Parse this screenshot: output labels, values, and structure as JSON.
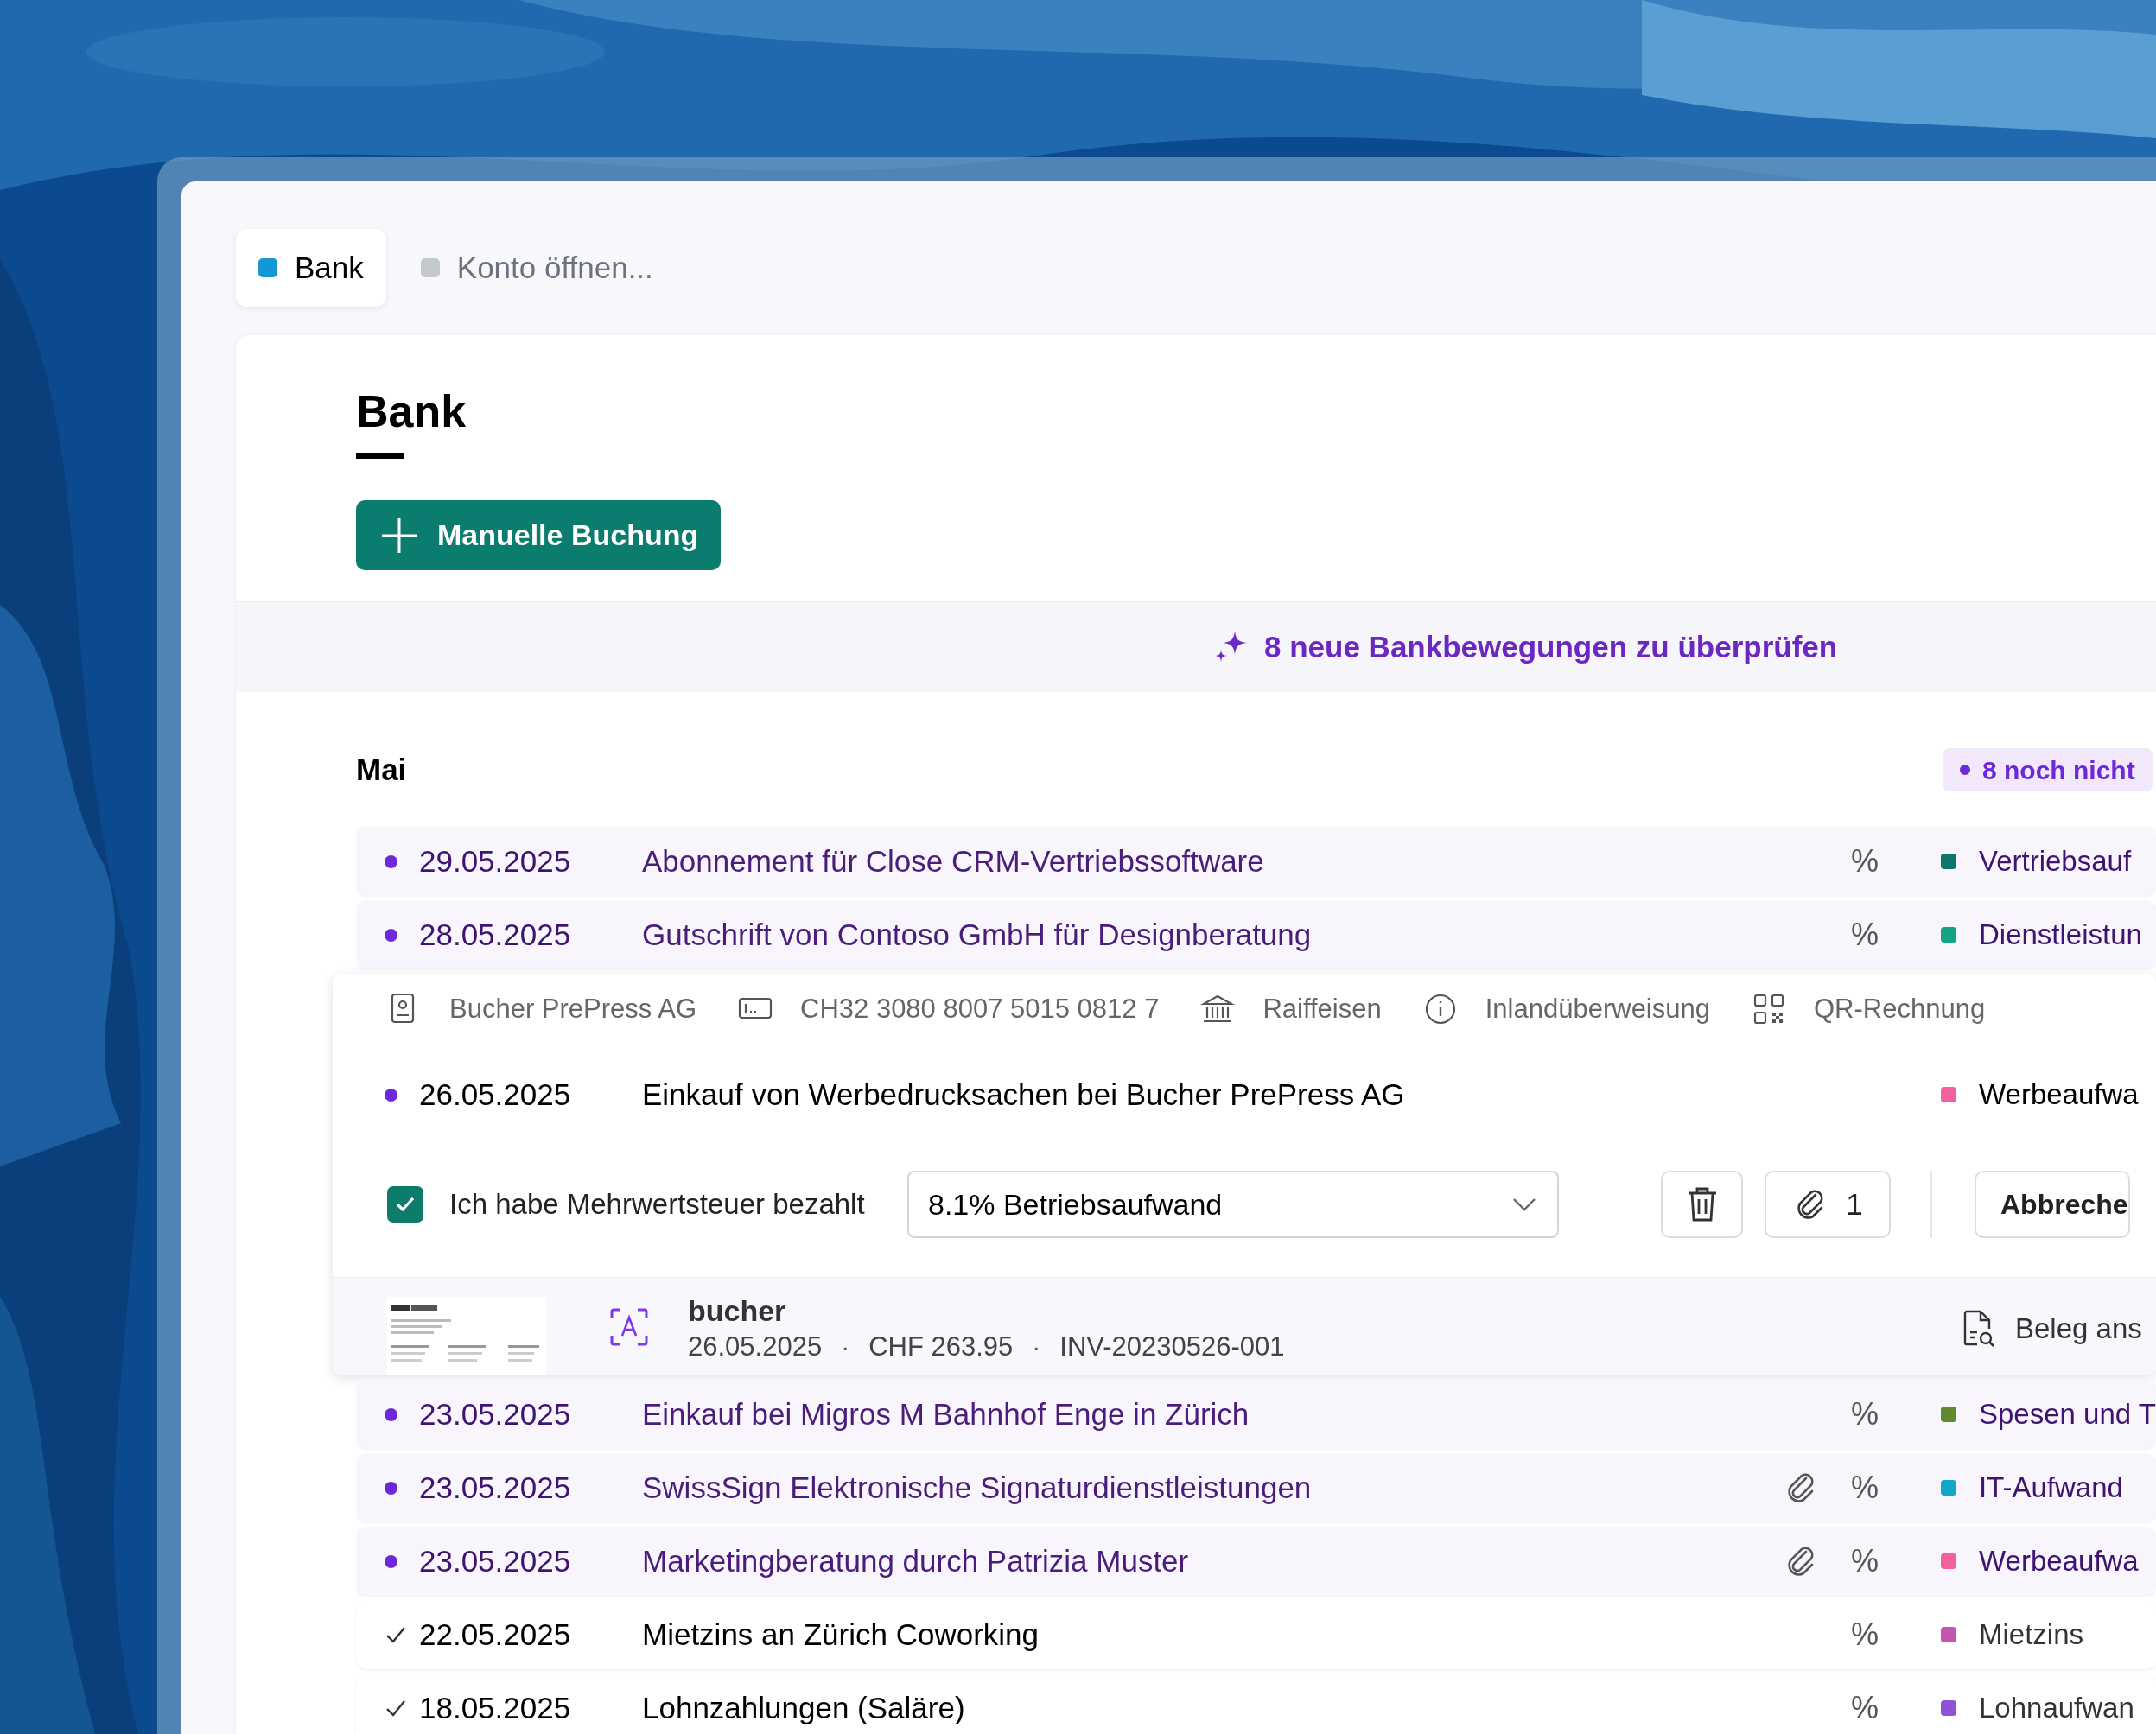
{
  "tabs": [
    {
      "label": "Bank",
      "color": "#1597d5",
      "selected": true
    },
    {
      "label": "Konto öffnen...",
      "color": "#c4c8cf",
      "selected": false
    }
  ],
  "page": {
    "title": "Bank",
    "primary_button": "Manuelle Buchung"
  },
  "banner": {
    "text": "8 neue Bankbewegungen zu überprüfen"
  },
  "month": {
    "label": "Mai",
    "badge": "8 noch nicht"
  },
  "transactions": [
    {
      "date": "29.05.2025",
      "description": "Abonnement für Close CRM-Vertriebssoftware",
      "vat": "%",
      "category": "Vertriebsauf",
      "color": "#0f766e",
      "reviewed": false,
      "attachment": false,
      "expanded": false
    },
    {
      "date": "28.05.2025",
      "description": "Gutschrift von Contoso GmbH für Designberatung",
      "vat": "%",
      "category": "Dienstleistun",
      "color": "#14a383",
      "reviewed": false,
      "attachment": false,
      "expanded": false
    },
    {
      "date": "26.05.2025",
      "description": "Einkauf von Werbedrucksachen bei Bucher PrePress AG",
      "category": "Werbeaufwa",
      "color": "#f2609d",
      "reviewed": false,
      "attachment": false,
      "expanded": true,
      "details": {
        "info": [
          {
            "kind": "contact",
            "text": "Bucher PrePress AG"
          },
          {
            "kind": "account",
            "text": "CH32 3080 8007 5015 0812 7"
          },
          {
            "kind": "bank",
            "text": "Raiffeisen"
          },
          {
            "kind": "info",
            "text": "Inlandüberweisung"
          },
          {
            "kind": "qr",
            "text": "QR-Rechnung"
          }
        ],
        "vat_checkbox": {
          "label": "Ich habe Mehrwertsteuer bezahlt",
          "checked": true
        },
        "vat_select": {
          "value": "8.1% Betriebsaufwand"
        },
        "attachment_count": "1",
        "cancel_button": "Abbreche",
        "receipt": {
          "vendor": "bucher",
          "meta": [
            "26.05.2025",
            "CHF 263.95",
            "INV-20230526-001"
          ],
          "separator": "·",
          "view_link": "Beleg ans"
        }
      }
    },
    {
      "date": "23.05.2025",
      "description": "Einkauf bei Migros M Bahnhof Enge in Zürich",
      "vat": "%",
      "category": "Spesen und T",
      "color": "#5f8a2e",
      "reviewed": false,
      "attachment": false,
      "expanded": false
    },
    {
      "date": "23.05.2025",
      "description": "SwissSign Elektronische Signaturdienstleistungen",
      "vat": "%",
      "category": "IT-Aufwand",
      "color": "#12a7c4",
      "reviewed": false,
      "attachment": true,
      "expanded": false
    },
    {
      "date": "23.05.2025",
      "description": "Marketingberatung durch Patrizia Muster",
      "vat": "%",
      "category": "Werbeaufwa",
      "color": "#f2609d",
      "reviewed": false,
      "attachment": true,
      "expanded": false
    },
    {
      "date": "22.05.2025",
      "description": "Mietzins an Zürich Coworking",
      "vat": "%",
      "category": "Mietzins",
      "color": "#c454b4",
      "reviewed": true,
      "attachment": false,
      "expanded": false
    },
    {
      "date": "18.05.2025",
      "description": "Lohnzahlungen (Saläre)",
      "vat": "%",
      "category": "Lohnaufwan",
      "color": "#8d52d6",
      "reviewed": true,
      "attachment": false,
      "expanded": false
    }
  ]
}
